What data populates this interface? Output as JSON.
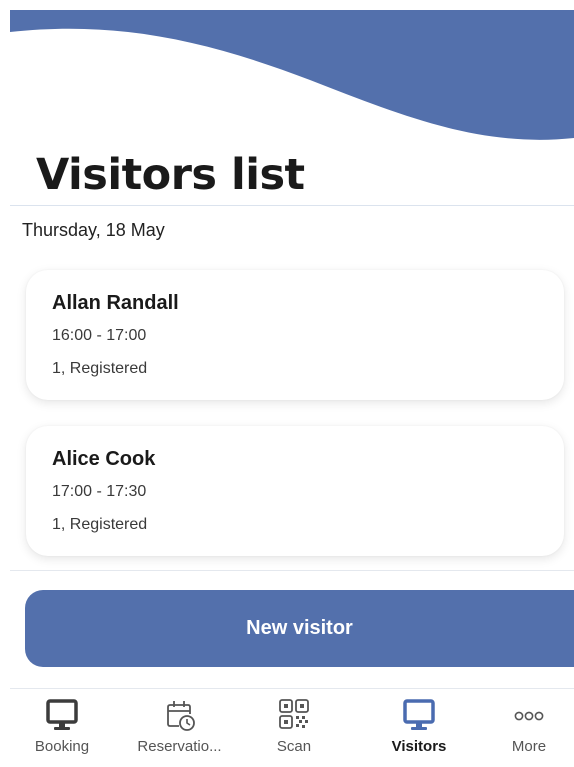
{
  "header": {
    "title": "Visitors list"
  },
  "list": {
    "date": "Thursday, 18 May",
    "visitors": [
      {
        "name": "Allan Randall",
        "time": "16:00 - 17:00",
        "status": "1, Registered"
      },
      {
        "name": "Alice Cook",
        "time": "17:00 - 17:30",
        "status": "1, Registered"
      }
    ]
  },
  "actions": {
    "new_visitor_label": "New visitor"
  },
  "bottom_nav": {
    "items": [
      {
        "label": "Booking",
        "icon": "monitor-icon",
        "active": false
      },
      {
        "label": "Reservatio...",
        "icon": "calendar-clock-icon",
        "active": false
      },
      {
        "label": "Scan",
        "icon": "qr-code-icon",
        "active": false
      },
      {
        "label": "Visitors",
        "icon": "monitor-icon",
        "active": true
      },
      {
        "label": "More",
        "icon": "more-dots-icon",
        "active": false
      }
    ]
  },
  "colors": {
    "brand": "#5370ac",
    "active_icon": "#4a6bb0",
    "inactive_icon": "#3c3c3c"
  }
}
